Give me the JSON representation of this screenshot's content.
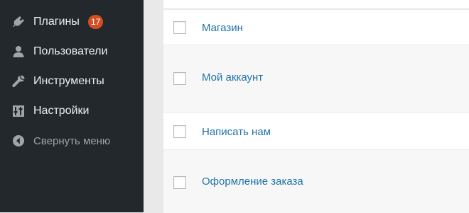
{
  "sidebar": {
    "items": [
      {
        "label": "Плагины",
        "icon": "plugin-icon",
        "badge": "17"
      },
      {
        "label": "Пользователи",
        "icon": "user-icon"
      },
      {
        "label": "Инструменты",
        "icon": "wrench-icon"
      },
      {
        "label": "Настройки",
        "icon": "settings-icon"
      },
      {
        "label": "Свернуть меню",
        "icon": "collapse-arrow-icon"
      }
    ]
  },
  "pages": {
    "rows": [
      {
        "title": "Магазин"
      },
      {
        "title": "Мой аккаунт"
      },
      {
        "title": "Написать нам"
      },
      {
        "title": "Оформление заказа"
      }
    ]
  },
  "colors": {
    "sidebar_bg": "#23282d",
    "badge": "#d54e21",
    "link": "#1f73aa"
  }
}
